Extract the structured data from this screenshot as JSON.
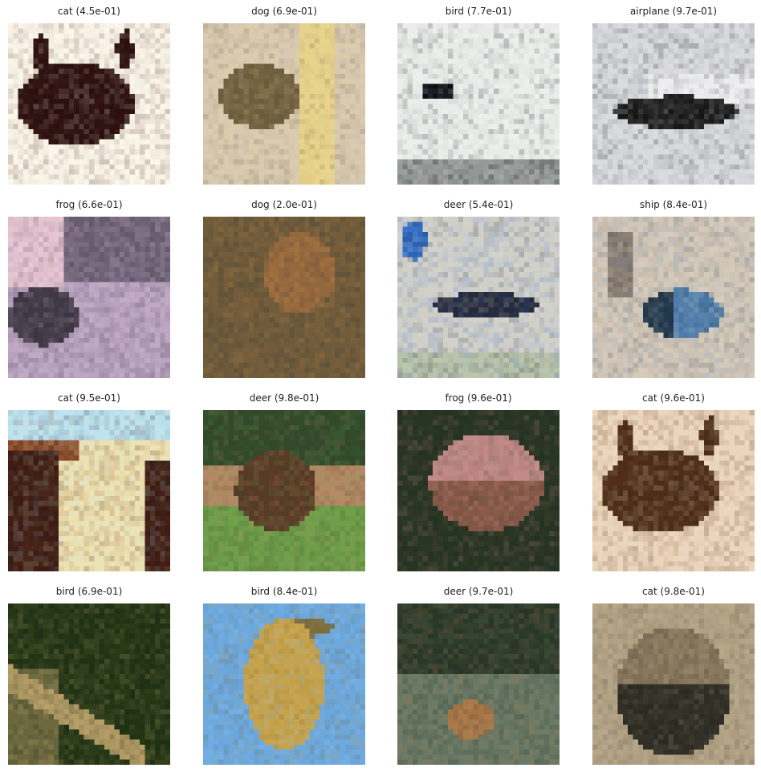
{
  "grid": {
    "panels": [
      {
        "label": "cat",
        "confidence": "4.5e-01",
        "caption": "cat (4.5e-01)",
        "palette": [
          "#fdf8ea",
          "#2a0f0e",
          "#5a2a1e",
          "#c8c8c0"
        ],
        "subject": "dark-blob"
      },
      {
        "label": "dog",
        "confidence": "6.9e-01",
        "caption": "dog (6.9e-01)",
        "palette": [
          "#d8cbb3",
          "#e9d48a",
          "#6b5a3a",
          "#b7a27a"
        ],
        "subject": "post"
      },
      {
        "label": "bird",
        "confidence": "7.7e-01",
        "caption": "bird (7.7e-01)",
        "palette": [
          "#eef0ee",
          "#0a0a12",
          "#8e9290",
          "#c9ccca"
        ],
        "subject": "small-dark"
      },
      {
        "label": "airplane",
        "confidence": "9.7e-01",
        "caption": "airplane (9.7e-01)",
        "palette": [
          "#d6d8dc",
          "#151515",
          "#8a8c90",
          "#f0f0f2"
        ],
        "subject": "plane"
      },
      {
        "label": "frog",
        "confidence": "6.6e-01",
        "caption": "frog (6.6e-01)",
        "palette": [
          "#b9a3c0",
          "#3b3540",
          "#e9c7d3",
          "#6f6278"
        ],
        "subject": "face"
      },
      {
        "label": "dog",
        "confidence": "2.0e-01",
        "caption": "dog (2.0e-01)",
        "palette": [
          "#6e5a3a",
          "#c08c46",
          "#2e3a3e",
          "#9a6a3e"
        ],
        "subject": "noisy"
      },
      {
        "label": "deer",
        "confidence": "5.4e-01",
        "caption": "deer (5.4e-01)",
        "palette": [
          "#d3d2cc",
          "#23273a",
          "#2f6bc4",
          "#b8c2a8"
        ],
        "subject": "stork"
      },
      {
        "label": "ship",
        "confidence": "8.4e-01",
        "caption": "ship (8.4e-01)",
        "palette": [
          "#d8ccbc",
          "#1e3448",
          "#4f7fae",
          "#8a7e72"
        ],
        "subject": "bird-blue"
      },
      {
        "label": "cat",
        "confidence": "9.5e-01",
        "caption": "cat (9.5e-01)",
        "palette": [
          "#efe3b2",
          "#3a1a12",
          "#b9e3f2",
          "#8a4a2a"
        ],
        "subject": "wall"
      },
      {
        "label": "deer",
        "confidence": "9.8e-01",
        "caption": "deer (9.8e-01)",
        "palette": [
          "#6ea04a",
          "#5a3a26",
          "#2f4a2a",
          "#b58a66"
        ],
        "subject": "horse"
      },
      {
        "label": "frog",
        "confidence": "9.6e-01",
        "caption": "frog (9.6e-01)",
        "palette": [
          "#243222",
          "#8b5a4a",
          "#c48c8c",
          "#3e4a2e"
        ],
        "subject": "frog"
      },
      {
        "label": "cat",
        "confidence": "9.6e-01",
        "caption": "cat (9.6e-01)",
        "palette": [
          "#ead5bc",
          "#4a2a16",
          "#7a4a26",
          "#f2e2cc"
        ],
        "subject": "dark-blob"
      },
      {
        "label": "bird",
        "confidence": "6.9e-01",
        "caption": "bird (6.9e-01)",
        "palette": [
          "#243616",
          "#b8a068",
          "#0e140a",
          "#6e6a40"
        ],
        "subject": "diagonal"
      },
      {
        "label": "bird",
        "confidence": "8.4e-01",
        "caption": "bird (8.4e-01)",
        "palette": [
          "#6aa8e0",
          "#c8a248",
          "#7a6a3a",
          "#9ec6ec"
        ],
        "subject": "yellow-bird"
      },
      {
        "label": "deer",
        "confidence": "9.7e-01",
        "caption": "deer (9.7e-01)",
        "palette": [
          "#2c3a2a",
          "#b07a4a",
          "#6a7a66",
          "#1a2418"
        ],
        "subject": "deer"
      },
      {
        "label": "cat",
        "confidence": "9.8e-01",
        "caption": "cat (9.8e-01)",
        "palette": [
          "#5a4a3a",
          "#8a7a60",
          "#2a2a22",
          "#b8a88a"
        ],
        "subject": "cat-face"
      }
    ]
  }
}
